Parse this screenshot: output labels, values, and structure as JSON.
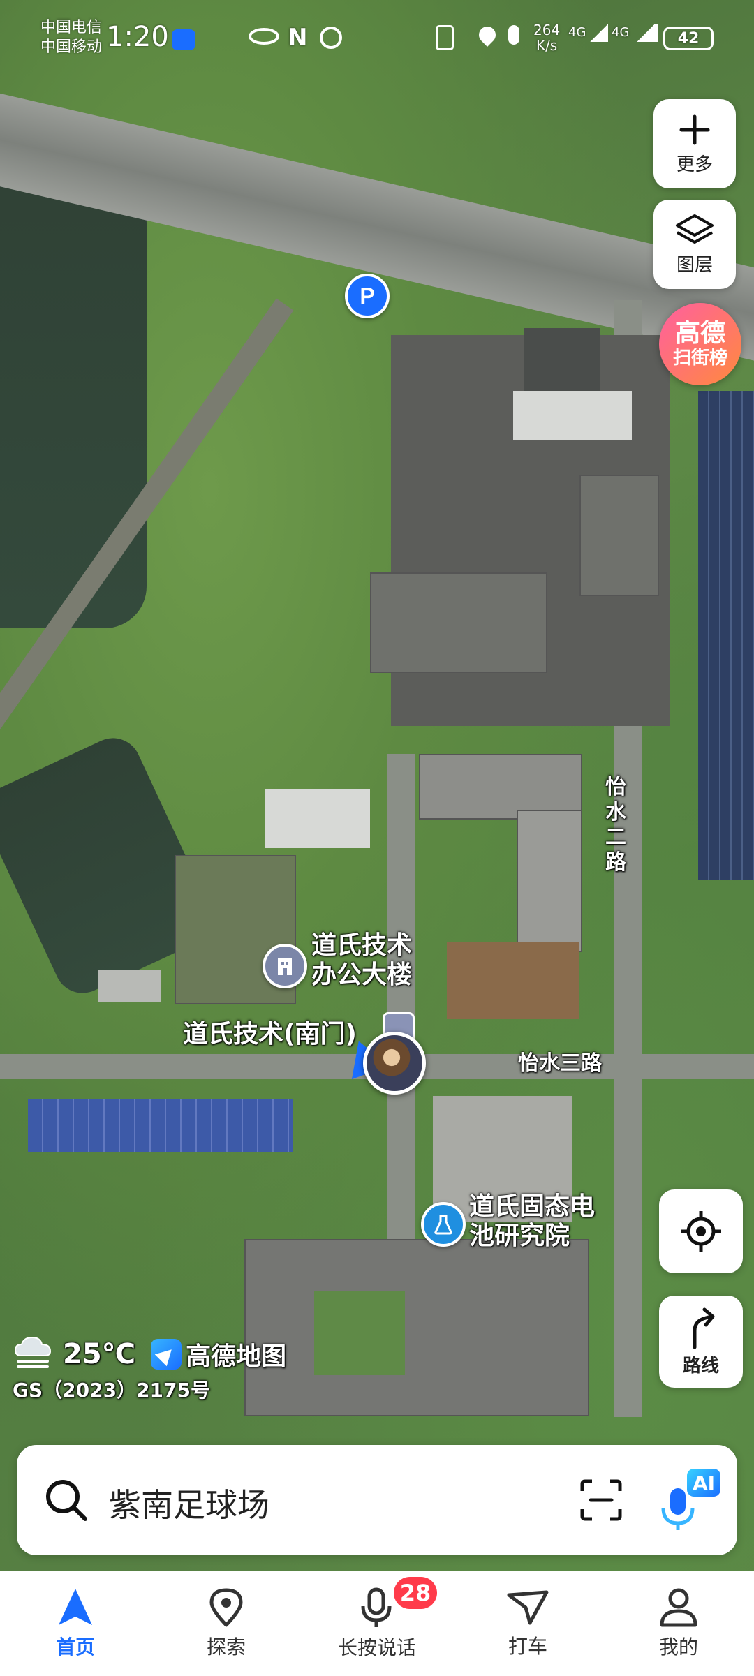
{
  "status_bar": {
    "carrier1": "中国电信",
    "carrier2": "中国移动",
    "time": "1:20",
    "net_speed_value": "264",
    "net_speed_unit": "K/s",
    "sig1": "4G",
    "sig2": "4G",
    "battery": "42"
  },
  "controls": {
    "more_label": "更多",
    "layers_label": "图层",
    "rank_line1": "高德",
    "rank_line2": "扫街榜",
    "route_label": "路线"
  },
  "map_labels": {
    "road_vertical": "怡水二路",
    "road_horizontal": "怡水三路",
    "poi_office_line1": "道氏技术",
    "poi_office_line2": "办公大楼",
    "poi_gate": "道氏技术(南门)",
    "poi_lab_line1": "道氏固态电",
    "poi_lab_line2": "池研究院"
  },
  "weather": {
    "temperature": "25℃",
    "brand": "高德地图",
    "license": "GS（2023）2175号"
  },
  "search": {
    "placeholder": "紫南足球场",
    "ai_badge": "AI"
  },
  "bottom_nav": {
    "items": [
      {
        "label": "首页",
        "active": true
      },
      {
        "label": "探索",
        "active": false
      },
      {
        "label": "长按说话",
        "active": false,
        "badge": "28"
      },
      {
        "label": "打车",
        "active": false
      },
      {
        "label": "我的",
        "active": false
      }
    ]
  },
  "colors": {
    "accent": "#1a6dff",
    "badge": "#ff3b4a",
    "rank_gradient_start": "#ff5fa0",
    "rank_gradient_end": "#ff8a3d"
  }
}
